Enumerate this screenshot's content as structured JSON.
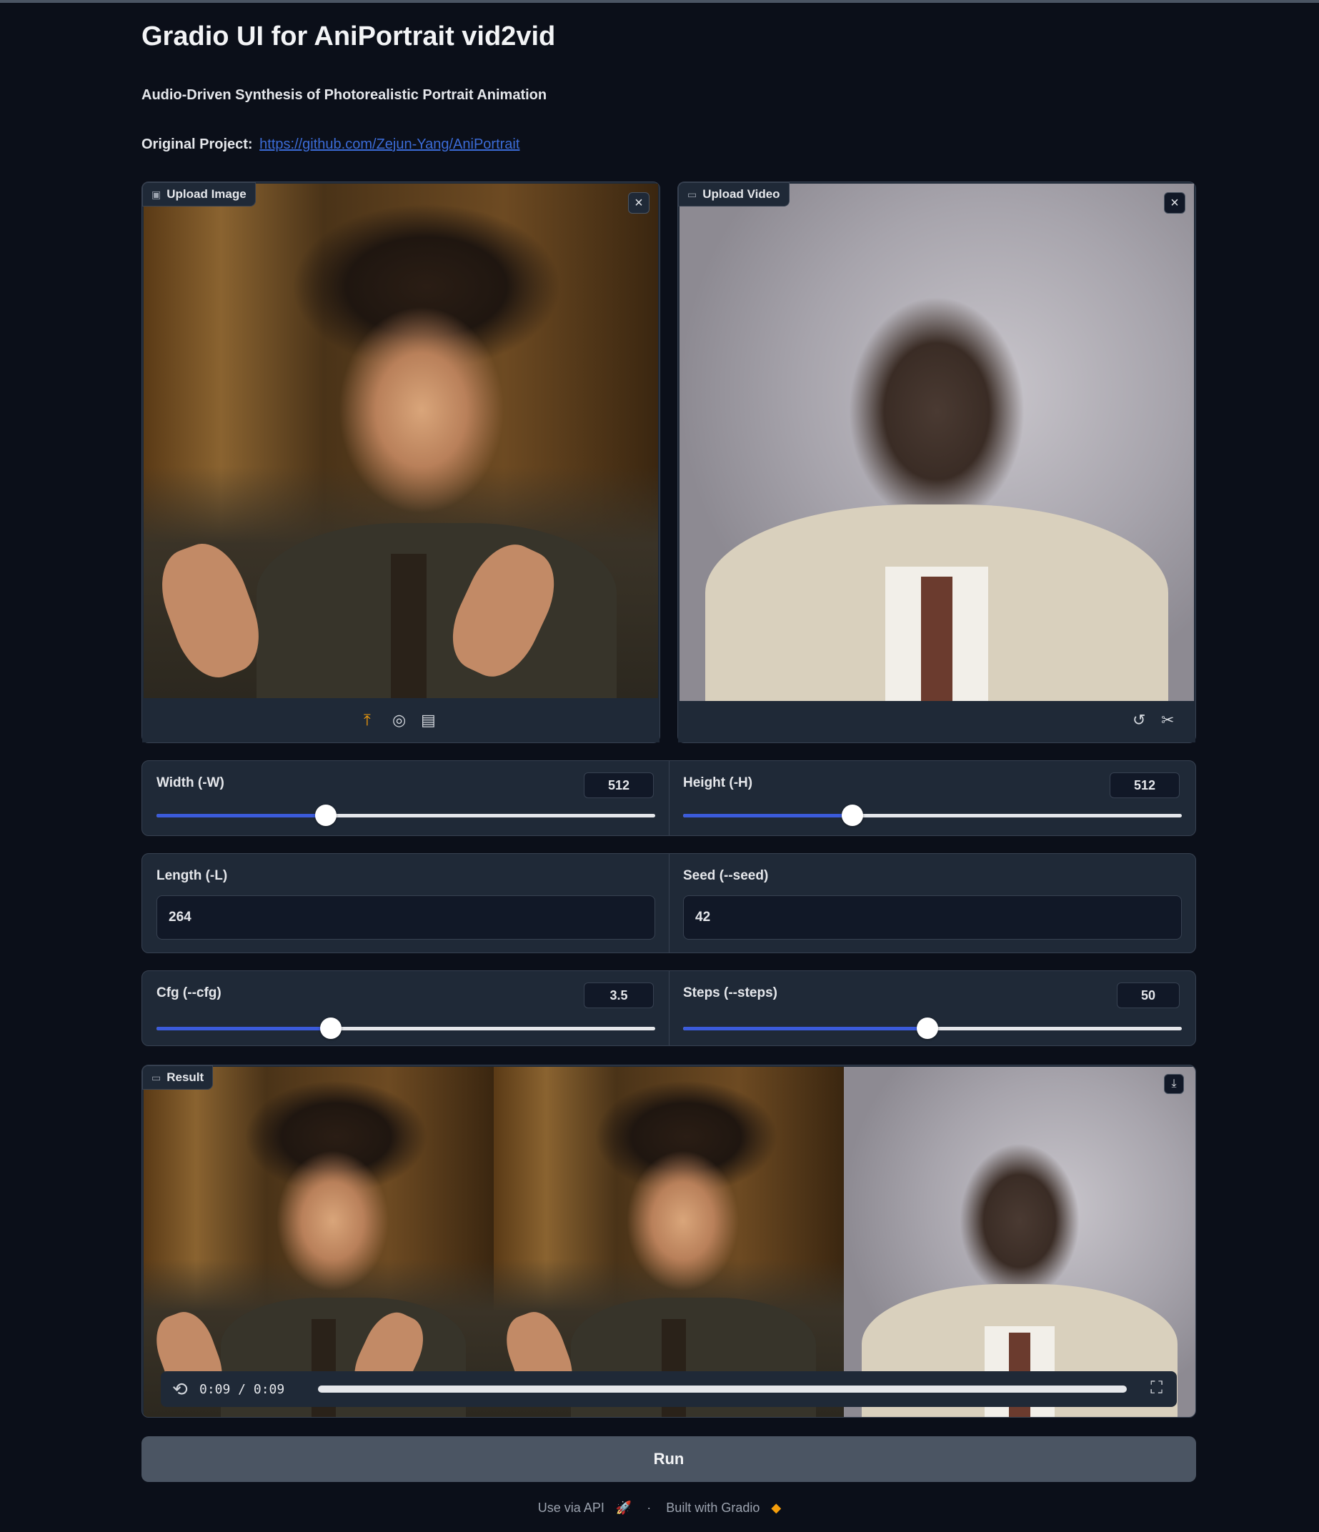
{
  "header": {
    "title": "Gradio UI for AniPortrait vid2vid",
    "subtitle": "Audio-Driven Synthesis of Photorealistic Portrait Animation",
    "project_label": "Original Project:",
    "project_link": "https://github.com/Zejun-Yang/AniPortrait"
  },
  "upload_image": {
    "label": "Upload Image",
    "icon": "image-icon",
    "toolbar_icons": [
      "upload-icon",
      "webcam-icon",
      "clipboard-icon"
    ]
  },
  "upload_video": {
    "label": "Upload Video",
    "icon": "video-icon",
    "toolbar_icons": [
      "undo-icon",
      "scissors-icon"
    ]
  },
  "sliders": {
    "width": {
      "label": "Width (-W)",
      "value": "512",
      "fraction": 0.34
    },
    "height": {
      "label": "Height (-H)",
      "value": "512",
      "fraction": 0.34
    },
    "cfg": {
      "label": "Cfg (--cfg)",
      "value": "3.5",
      "fraction": 0.35
    },
    "steps": {
      "label": "Steps (--steps)",
      "value": "50",
      "fraction": 0.49
    }
  },
  "inputs": {
    "length": {
      "label": "Length (-L)",
      "value": "264"
    },
    "seed": {
      "label": "Seed (--seed)",
      "value": "42"
    }
  },
  "result": {
    "label": "Result",
    "time": "0:09 / 0:09",
    "progress": 1.0
  },
  "run_button": "Run",
  "footer": {
    "api": "Use via API",
    "separator": "·",
    "built": "Built with Gradio"
  },
  "colors": {
    "background": "#0b0f19",
    "panel": "#1f2937",
    "accent": "#3b5bdb",
    "link": "#3b6bd6"
  }
}
